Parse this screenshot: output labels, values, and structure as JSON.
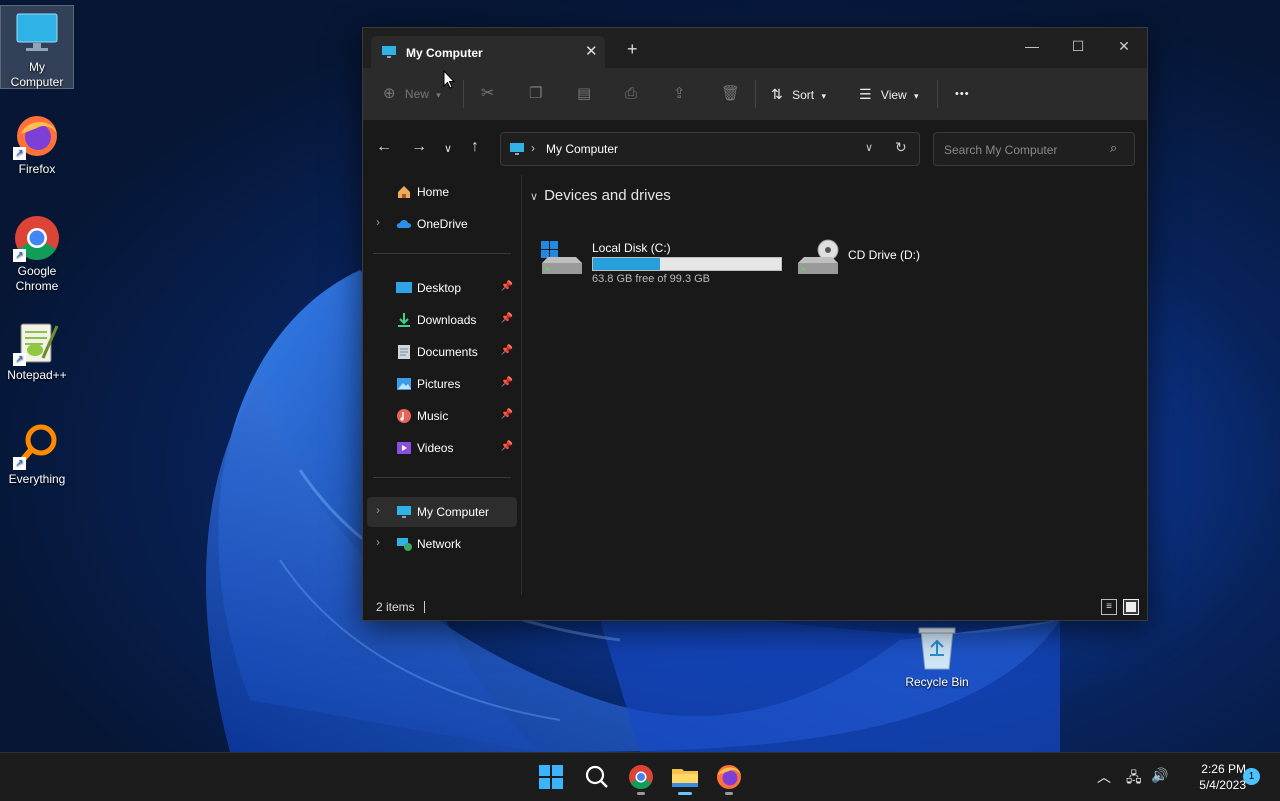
{
  "desktop": {
    "icons": [
      {
        "label": "My Computer",
        "icon": "monitor-icon"
      },
      {
        "label": "Firefox",
        "icon": "firefox-icon"
      },
      {
        "label": "Google Chrome",
        "icon": "chrome-icon"
      },
      {
        "label": "Notepad++",
        "icon": "notepadpp-icon"
      },
      {
        "label": "Everything",
        "icon": "everything-icon"
      }
    ],
    "recycle_bin": "Recycle Bin"
  },
  "window": {
    "tab_title": "My Computer",
    "tab_close": "✕",
    "new_tab": "+",
    "controls": {
      "minimize": "—",
      "maximize": "☐",
      "close": "✕"
    },
    "toolbar": {
      "new_label": "New",
      "sort_label": "Sort",
      "view_label": "View",
      "more": "•••"
    },
    "address": {
      "path": "My Computer"
    },
    "search": {
      "placeholder": "Search My Computer"
    },
    "nav_pane": {
      "top": [
        {
          "label": "Home",
          "icon": "home-icon"
        },
        {
          "label": "OneDrive",
          "icon": "cloud-icon"
        }
      ],
      "pinned": [
        {
          "label": "Desktop",
          "icon": "desktop-folder-icon"
        },
        {
          "label": "Downloads",
          "icon": "download-icon"
        },
        {
          "label": "Documents",
          "icon": "document-icon"
        },
        {
          "label": "Pictures",
          "icon": "pictures-icon"
        },
        {
          "label": "Music",
          "icon": "music-icon"
        },
        {
          "label": "Videos",
          "icon": "video-icon"
        }
      ],
      "bottom": [
        {
          "label": "My Computer",
          "icon": "monitor-icon"
        },
        {
          "label": "Network",
          "icon": "network-icon"
        }
      ]
    },
    "content": {
      "group_header": "Devices and drives",
      "drives": [
        {
          "name": "Local Disk (C:)",
          "free_text": "63.8 GB free of 99.3 GB",
          "used_fraction": 0.357,
          "icon": "hard-drive-icon"
        },
        {
          "name": "CD Drive (D:)",
          "icon": "cd-drive-icon"
        }
      ]
    },
    "status": {
      "items": "2 items"
    }
  },
  "taskbar": {
    "clock_time": "2:26 PM",
    "clock_date": "5/4/2023",
    "notification_count": "1",
    "apps": [
      "start-icon",
      "search-icon",
      "chrome-icon",
      "file-explorer-icon",
      "firefox-icon"
    ]
  },
  "colors": {
    "accent": "#26a0da",
    "window_bg": "#191919",
    "taskbar_bg": "#1c1c1c"
  }
}
